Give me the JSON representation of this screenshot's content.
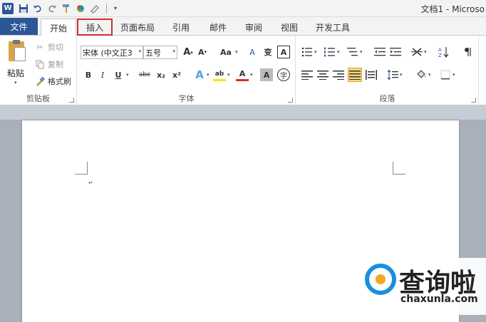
{
  "window": {
    "title": "文档1 - Microso"
  },
  "quick_access": {
    "icons": [
      "word-icon",
      "save-icon",
      "undo-icon",
      "redo-icon",
      "format-painter-icon",
      "color-icon",
      "eraser-icon",
      "customize-icon"
    ],
    "word_letter": "W"
  },
  "tabs": {
    "file": "文件",
    "items": [
      "开始",
      "插入",
      "页面布局",
      "引用",
      "邮件",
      "审阅",
      "视图",
      "开发工具"
    ],
    "active": "开始",
    "highlighted": "插入",
    "highlight_color": "#d32f2f"
  },
  "clipboard": {
    "paste": "粘贴",
    "cut": "剪切",
    "copy": "复制",
    "format_painter": "格式刷",
    "group_label": "剪贴板"
  },
  "font": {
    "font_name": "宋体 (中文正3",
    "font_size": "五号",
    "grow": "A",
    "shrink": "A",
    "change_case": "Aa",
    "bold": "B",
    "italic": "I",
    "underline": "U",
    "strikethrough": "abc",
    "subscript": "x₂",
    "superscript": "x²",
    "text_effect": "A",
    "highlight": "ab",
    "font_color": "A",
    "char_shading": "A",
    "enclose_char": "字",
    "clear_format": "A",
    "pinyin": "变",
    "char_border": "A",
    "group_label": "字体",
    "font_color_hex": "#d32f2f",
    "highlight_hex": "#f5e600"
  },
  "paragraph": {
    "group_label": "段落"
  },
  "document": {
    "cursor_glyph": "↵"
  },
  "watermark": {
    "text": "查询啦",
    "url": "chaxunla.com"
  }
}
